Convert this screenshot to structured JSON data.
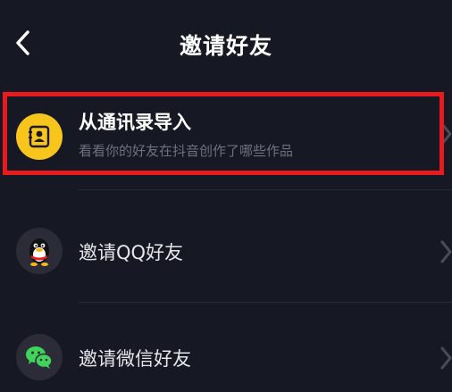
{
  "header": {
    "title": "邀请好友",
    "back_icon": "chevron-left-icon"
  },
  "items": [
    {
      "label": "从通讯录导入",
      "subtitle": "看看你的好友在抖音创作了哪些作品",
      "icon": "contacts-icon",
      "icon_color": "#f7c51c",
      "highlighted": true
    },
    {
      "label": "邀请QQ好友",
      "icon": "qq-penguin-icon"
    },
    {
      "label": "邀请微信好友",
      "icon": "wechat-icon",
      "icon_color": "#3fd35a"
    }
  ],
  "colors": {
    "background": "#161823",
    "highlight_border": "#e81a1e",
    "subtitle": "#6f7080"
  }
}
